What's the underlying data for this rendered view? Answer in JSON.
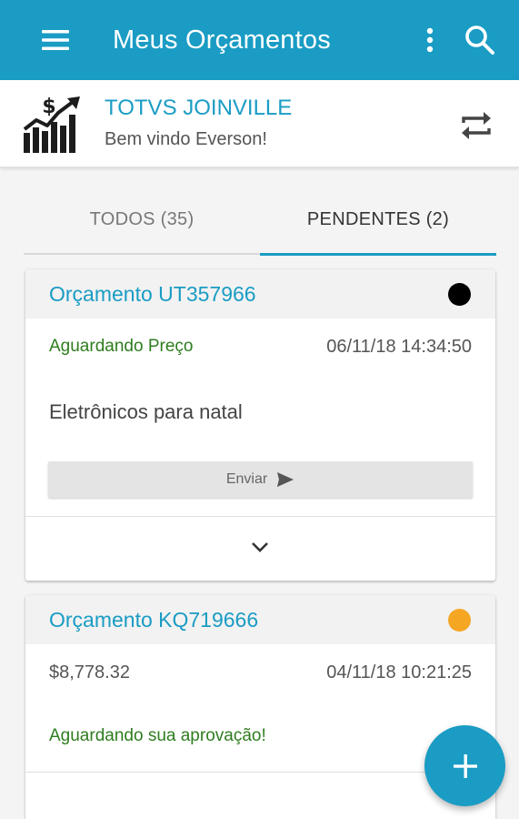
{
  "appbar": {
    "title": "Meus Orçamentos",
    "icons": {
      "menu": "menu-icon",
      "more": "more-vert-icon",
      "search": "search-icon"
    }
  },
  "org": {
    "name": "TOTVS JOINVILLE",
    "welcome": "Bem vindo Everson!",
    "logo_icon": "finance-growth-icon",
    "switch_icon": "swap-icon"
  },
  "tabs": [
    {
      "label": "TODOS (35)",
      "selected": false
    },
    {
      "label": "PENDENTES (2)",
      "selected": true
    }
  ],
  "quotes": [
    {
      "title": "Orçamento UT357966",
      "status_color": "#000000",
      "status": "Aguardando Preço",
      "datetime": "06/11/18 14:34:50",
      "description": "Eletrônicos para natal",
      "send_label": "Enviar"
    },
    {
      "title": "Orçamento KQ719666",
      "status_color": "#f5a623",
      "amount": "$8,778.32",
      "datetime": "04/11/18 10:21:25",
      "status": "Aguardando sua aprovação!"
    }
  ],
  "fab": {
    "icon": "plus-icon"
  },
  "colors": {
    "primary": "#1a9cc4",
    "status_green": "#2e7d1f"
  }
}
